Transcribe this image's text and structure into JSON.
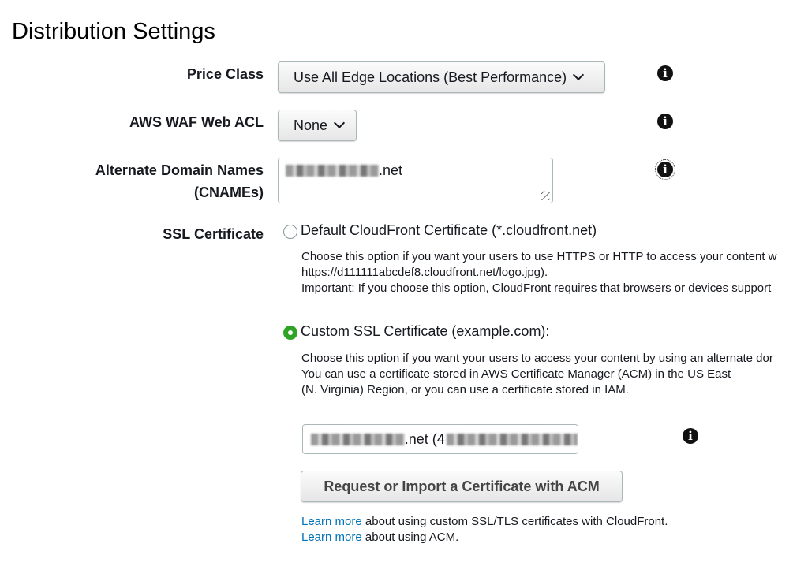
{
  "page": {
    "title": "Distribution Settings"
  },
  "price_class": {
    "label": "Price Class",
    "value": "Use All Edge Locations (Best Performance)",
    "info_icon": "info-icon"
  },
  "waf": {
    "label": "AWS WAF Web ACL",
    "value": "None",
    "info_icon": "info-icon"
  },
  "cnames": {
    "label_line1": "Alternate Domain Names",
    "label_line2": "(CNAMEs)",
    "value_suffix": ".net",
    "info_icon": "info-icon"
  },
  "ssl": {
    "label": "SSL Certificate",
    "default_option": {
      "label": "Default CloudFront Certificate (*.cloudfront.net)",
      "selected": false,
      "desc_line1": "Choose this option if you want your users to use HTTPS or HTTP to access your content w",
      "desc_line2": "https://d111111abcdef8.cloudfront.net/logo.jpg).",
      "desc_line3": "Important: If you choose this option, CloudFront requires that browsers or devices support"
    },
    "custom_option": {
      "label": "Custom SSL Certificate (example.com):",
      "selected": true,
      "desc_line1": "Choose this option if you want your users to access your content by using an alternate dor",
      "desc_line2": "You can use a certificate stored in AWS Certificate Manager (ACM) in the US East",
      "desc_line3": "(N. Virginia) Region, or you can use a certificate stored in IAM."
    },
    "certificate_field": {
      "visible_text": ".net (4"
    },
    "request_button": "Request or Import a Certificate with ACM",
    "learn_more_1": {
      "link": "Learn more",
      "text": " about using custom SSL/TLS certificates with CloudFront."
    },
    "learn_more_2": {
      "link": "Learn more",
      "text": " about using ACM."
    }
  },
  "colors": {
    "radio_selected": "#2ea325",
    "link": "#0073bb"
  }
}
